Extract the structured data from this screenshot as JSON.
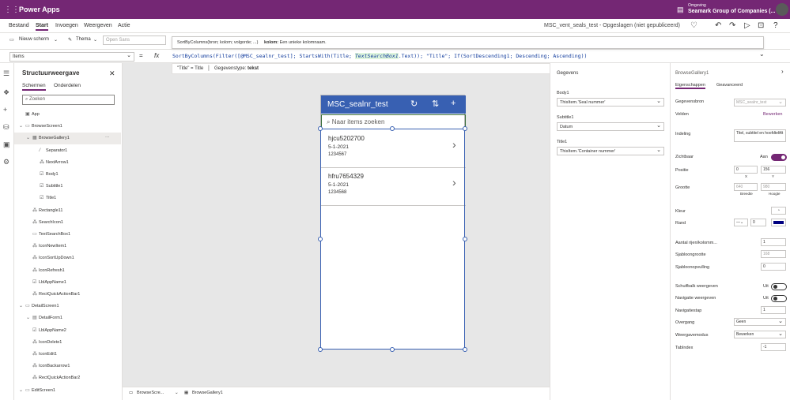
{
  "topbar": {
    "app_name": "Power Apps",
    "env_label": "Omgeving",
    "env_name": "Seamark Group of Companies (..."
  },
  "menu": {
    "items": [
      "Bestand",
      "Start",
      "Invoegen",
      "Weergeven",
      "Actie"
    ],
    "active": "Start",
    "doc_title": "MSC_vent_seals_test - Opgeslagen (niet gepubliceerd)"
  },
  "toolbar": {
    "new_screen": "Nieuw scherm",
    "theme": "Thema",
    "font": "Open Sans"
  },
  "formula": {
    "property": "Items",
    "fx": "fx",
    "part1": "SortByColumns(Filter([@MSC_sealnr_test]; StartsWith(Title; ",
    "highlight": "TextSearchBox1",
    "part2": ".Text)); \"Title\"; If(SortDescending1; Descending; Ascending))",
    "tooltip_sig": "SortByColumns(bron; kolom; volgorde; ...)",
    "tooltip_key": "kolom:",
    "tooltip_desc": "Een unieke kolomnaam.",
    "help_left": "\"Title\" = Title",
    "help_type_label": "Gegevenstype:",
    "help_type": "tekst"
  },
  "tree": {
    "title": "Structuurweergave",
    "tabs": [
      "Schermen",
      "Onderdelen"
    ],
    "search_placeholder": "Zoeken",
    "rows": [
      {
        "label": "App",
        "indent": 0,
        "icon": "▣"
      },
      {
        "label": "BrowseScreen1",
        "indent": 0,
        "icon": "▭"
      },
      {
        "label": "BrowseGallery1",
        "indent": 1,
        "icon": "▦"
      },
      {
        "label": "Separator1",
        "indent": 2,
        "icon": "⁄"
      },
      {
        "label": "NextArrow1",
        "indent": 2,
        "icon": "⁂"
      },
      {
        "label": "Body1",
        "indent": 2,
        "icon": "☑"
      },
      {
        "label": "Subtitle1",
        "indent": 2,
        "icon": "☑"
      },
      {
        "label": "Title1",
        "indent": 2,
        "icon": "☑"
      },
      {
        "label": "Rectangle11",
        "indent": 1,
        "icon": "⁂"
      },
      {
        "label": "SearchIcon1",
        "indent": 1,
        "icon": "⁂"
      },
      {
        "label": "TextSearchBox1",
        "indent": 1,
        "icon": "▭"
      },
      {
        "label": "IconNewItem1",
        "indent": 1,
        "icon": "⁂"
      },
      {
        "label": "IconSortUpDown1",
        "indent": 1,
        "icon": "⁂"
      },
      {
        "label": "IconRefresh1",
        "indent": 1,
        "icon": "⁂"
      },
      {
        "label": "LblAppName1",
        "indent": 1,
        "icon": "☑"
      },
      {
        "label": "RectQuickActionBar1",
        "indent": 1,
        "icon": "⁂"
      },
      {
        "label": "DetailScreen1",
        "indent": 0,
        "icon": "▭"
      },
      {
        "label": "DetailForm1",
        "indent": 1,
        "icon": "▤"
      },
      {
        "label": "LblAppName2",
        "indent": 1,
        "icon": "☑"
      },
      {
        "label": "IconDelete1",
        "indent": 1,
        "icon": "⁂"
      },
      {
        "label": "IconEdit1",
        "indent": 1,
        "icon": "⁂"
      },
      {
        "label": "IconBackarrow1",
        "indent": 1,
        "icon": "⁂"
      },
      {
        "label": "RectQuickActionBar2",
        "indent": 1,
        "icon": "⁂"
      },
      {
        "label": "EditScreen1",
        "indent": 0,
        "icon": "▭"
      }
    ]
  },
  "phone": {
    "title": "MSC_sealnr_test",
    "search_placeholder": "Naar items zoeken",
    "items": [
      {
        "title": "hjcu5202700",
        "subtitle": "5-1-2021",
        "body": "1234567"
      },
      {
        "title": "hfru7654329",
        "subtitle": "5-1-2021",
        "body": "1234568"
      }
    ]
  },
  "bottom": {
    "screen": "BrowseScre...",
    "control": "BrowseGallery1"
  },
  "data_panel": {
    "header": "Gegevens",
    "fields": [
      {
        "label": "Body1",
        "value": "ThisItem.'Seal nummer'"
      },
      {
        "label": "Subtitle1",
        "value": "Datum"
      },
      {
        "label": "Title1",
        "value": "ThisItem.'Container nummer'"
      }
    ]
  },
  "props": {
    "control_name": "BrowseGallery1",
    "tabs": [
      "Eigenschappen",
      "Geavanceerd"
    ],
    "datasource_label": "Gegevensbron",
    "datasource_value": "MSC_sealnr_test",
    "fields_label": "Velden",
    "fields_link": "Bewerken",
    "layout_label": "Indeling",
    "layout_value": "Titel, subtitel en hoofdtekst",
    "visible_label": "Zichtbaar",
    "visible_state": "Aan",
    "position_label": "Positie",
    "pos_x": "0",
    "pos_y": "156",
    "x_lbl": "X",
    "y_lbl": "Y",
    "size_label": "Grootte",
    "width": "640",
    "height": "980",
    "w_lbl": "Breedte",
    "h_lbl": "Hoogte",
    "color_label": "Kleur",
    "border_label": "Rand",
    "border_width": "0",
    "border_color": "#000080",
    "wrap_label": "Aantal rijen/kolomm...",
    "wrap_value": "1",
    "template_size_label": "Sjabloongrootte",
    "template_size": "168",
    "template_padding_label": "Sjabloonopvulling",
    "template_padding": "0",
    "scrollbar_label": "Schuifbalk weergeven",
    "scrollbar_state": "Uit",
    "navigation_label": "Navigatie weergeven",
    "navigation_state": "Uit",
    "navstep_label": "Navigatiestap",
    "navstep_value": "1",
    "transition_label": "Overgang",
    "transition_value": "Geen",
    "display_mode_label": "Weergavemodus",
    "display_mode_value": "Bewerken",
    "tabindex_label": "TabIndex",
    "tabindex_value": "-1"
  },
  "colors": {
    "brand": "#742774",
    "header_blue": "#3860b2",
    "accent_green": "#3a6e3a"
  }
}
